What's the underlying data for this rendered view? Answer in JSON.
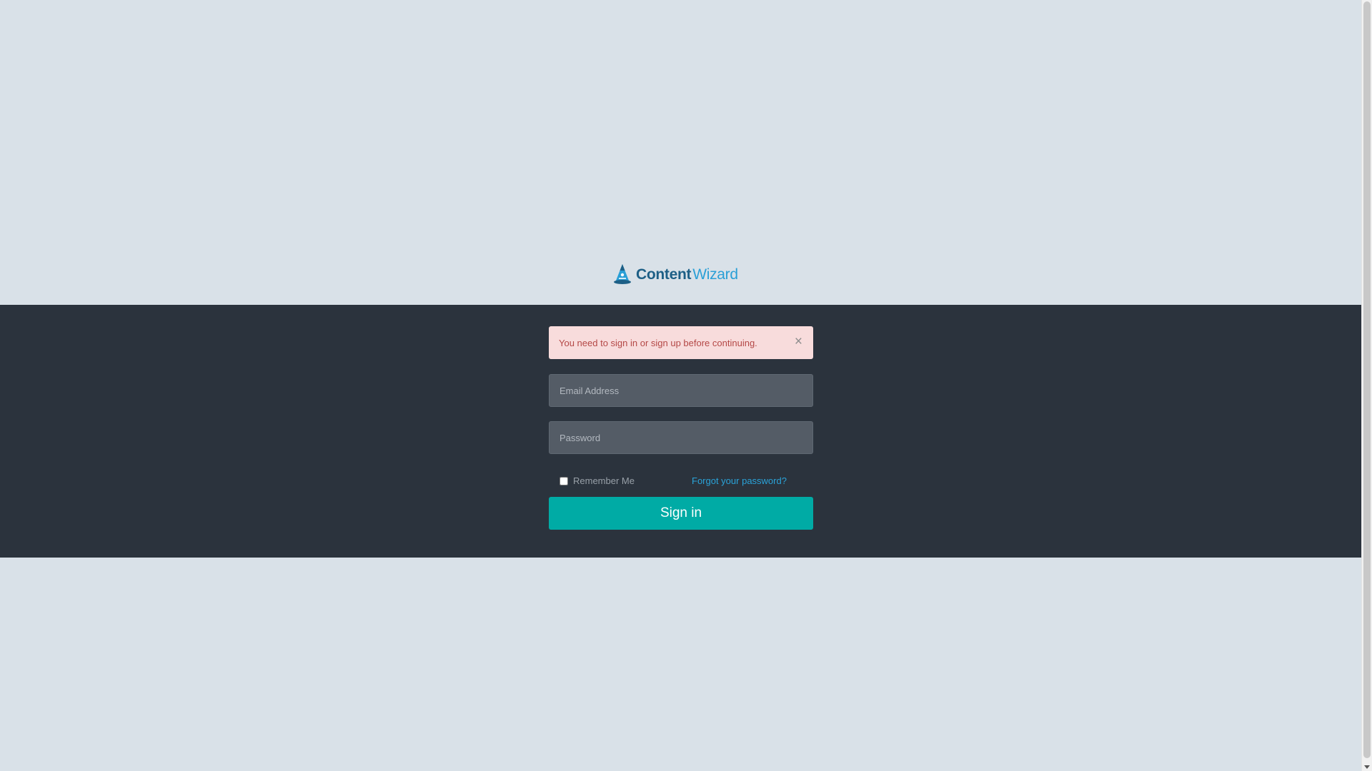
{
  "brand": {
    "word1": "Content",
    "word2": "Wizard",
    "icon": "wizard-hat-icon"
  },
  "alert": {
    "message": "You need to sign in or sign up before continuing.",
    "close_glyph": "×"
  },
  "form": {
    "email_placeholder": "Email Address",
    "password_placeholder": "Password",
    "remember_label": "Remember Me",
    "forgot_link": "Forgot your password?",
    "submit_label": "Sign in"
  },
  "colors": {
    "page_bg": "#d9e1e8",
    "band_bg": "#2b333d",
    "alert_bg": "#f8dcdc",
    "alert_text": "#b44846",
    "input_bg": "#545c66",
    "link": "#2aa3d9",
    "primary_button": "#00aba5",
    "brand_dark": "#1d5f86",
    "brand_light": "#2a9fd6"
  }
}
